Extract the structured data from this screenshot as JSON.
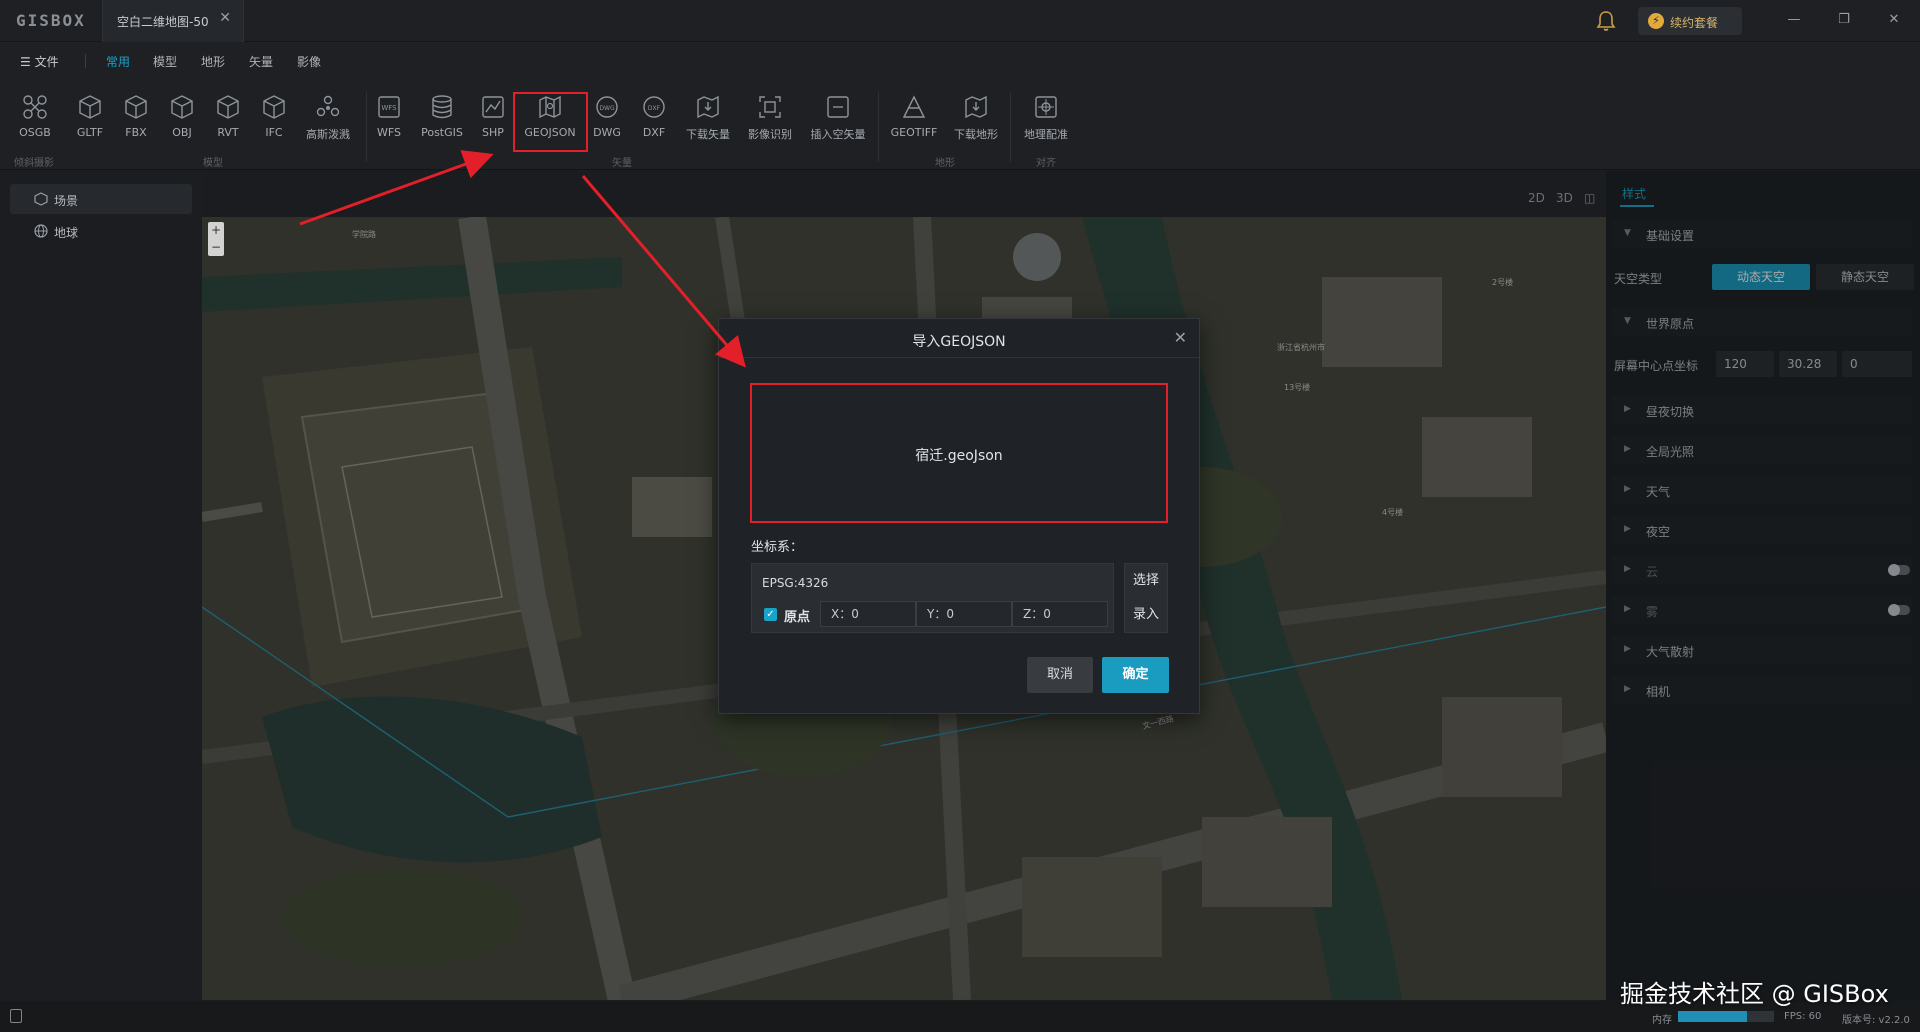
{
  "titlebar": {
    "logo": "GISBOX",
    "doc_tab": "空白二维地图-50",
    "close_glyph": "✕",
    "renew_label": "续约套餐",
    "minimize": "—",
    "maximize": "❐",
    "close": "✕"
  },
  "menubar": {
    "file": "☰ 文件",
    "tabs": [
      "常用",
      "模型",
      "地形",
      "矢量",
      "影像"
    ],
    "active_tab": "常用"
  },
  "ribbon": {
    "tools": [
      {
        "label": "OSGB",
        "icon": "osgb-icon"
      },
      {
        "label": "GLTF",
        "icon": "cube-icon"
      },
      {
        "label": "FBX",
        "icon": "cube-icon"
      },
      {
        "label": "OBJ",
        "icon": "cube-icon"
      },
      {
        "label": "RVT",
        "icon": "cube-icon"
      },
      {
        "label": "IFC",
        "icon": "cube-icon"
      },
      {
        "label": "高斯泼溅",
        "icon": "gaussian-icon"
      },
      {
        "label": "WFS",
        "icon": "wfs-icon"
      },
      {
        "label": "PostGIS",
        "icon": "database-icon"
      },
      {
        "label": "SHP",
        "icon": "shp-icon"
      },
      {
        "label": "GEOJSON",
        "icon": "geojson-icon"
      },
      {
        "label": "DWG",
        "icon": "dwg-icon"
      },
      {
        "label": "DXF",
        "icon": "dxf-icon"
      },
      {
        "label": "下载矢量",
        "icon": "download-vector-icon"
      },
      {
        "label": "影像识别",
        "icon": "image-recognition-icon"
      },
      {
        "label": "插入空矢量",
        "icon": "insert-vector-icon"
      },
      {
        "label": "GEOTIFF",
        "icon": "geotiff-icon"
      },
      {
        "label": "下载地形",
        "icon": "download-terrain-icon"
      },
      {
        "label": "地理配准",
        "icon": "georeference-icon"
      }
    ],
    "groups": [
      "倾斜摄影",
      "模型",
      "矢量",
      "地形",
      "对齐"
    ]
  },
  "leftpanel": {
    "items": [
      {
        "label": "场景",
        "icon": "scene-icon"
      },
      {
        "label": "地球",
        "icon": "globe-icon"
      }
    ]
  },
  "viewbar": {
    "modes": [
      "2D",
      "3D",
      "◫"
    ]
  },
  "map": {
    "zoom_in": "+",
    "zoom_out": "−",
    "labels": [
      "浙江省杭州市",
      "文一西路",
      "13号楼",
      "2号楼",
      "4号楼",
      "学院路"
    ]
  },
  "rightpanel": {
    "tab": "样式",
    "basic": "基础设置",
    "sky_type": "天空类型",
    "sky_dynamic": "动态天空",
    "sky_static": "静态天空",
    "world_origin": "世界原点",
    "screen_center": "屏幕中心点坐标",
    "coords": [
      "120",
      "30.28",
      "0"
    ],
    "sections": [
      "昼夜切换",
      "全局光照",
      "天气",
      "夜空",
      "云",
      "雾",
      "大气散射",
      "相机"
    ]
  },
  "dialog": {
    "title": "导入GEOJSON",
    "close": "✕",
    "file_name": "宿迁.geoJson",
    "crs_label": "坐标系：",
    "crs_value": "EPSG:4326",
    "origin_label": "原点",
    "origin_checked": true,
    "x": "X：0",
    "y": "Y：0",
    "z": "Z：0",
    "select": "选择",
    "input": "录入",
    "cancel": "取消",
    "ok": "确定"
  },
  "statusbar": {
    "memory_label": "内存",
    "memory_usage": 0.72,
    "fps": "FPS: 60",
    "version": "版本号: v2.2.0"
  },
  "watermark": "掘金技术社区 @ GISBox",
  "colors": {
    "accent": "#1aa3c9",
    "highlight": "#e3202a",
    "gold": "#e2a93b"
  }
}
